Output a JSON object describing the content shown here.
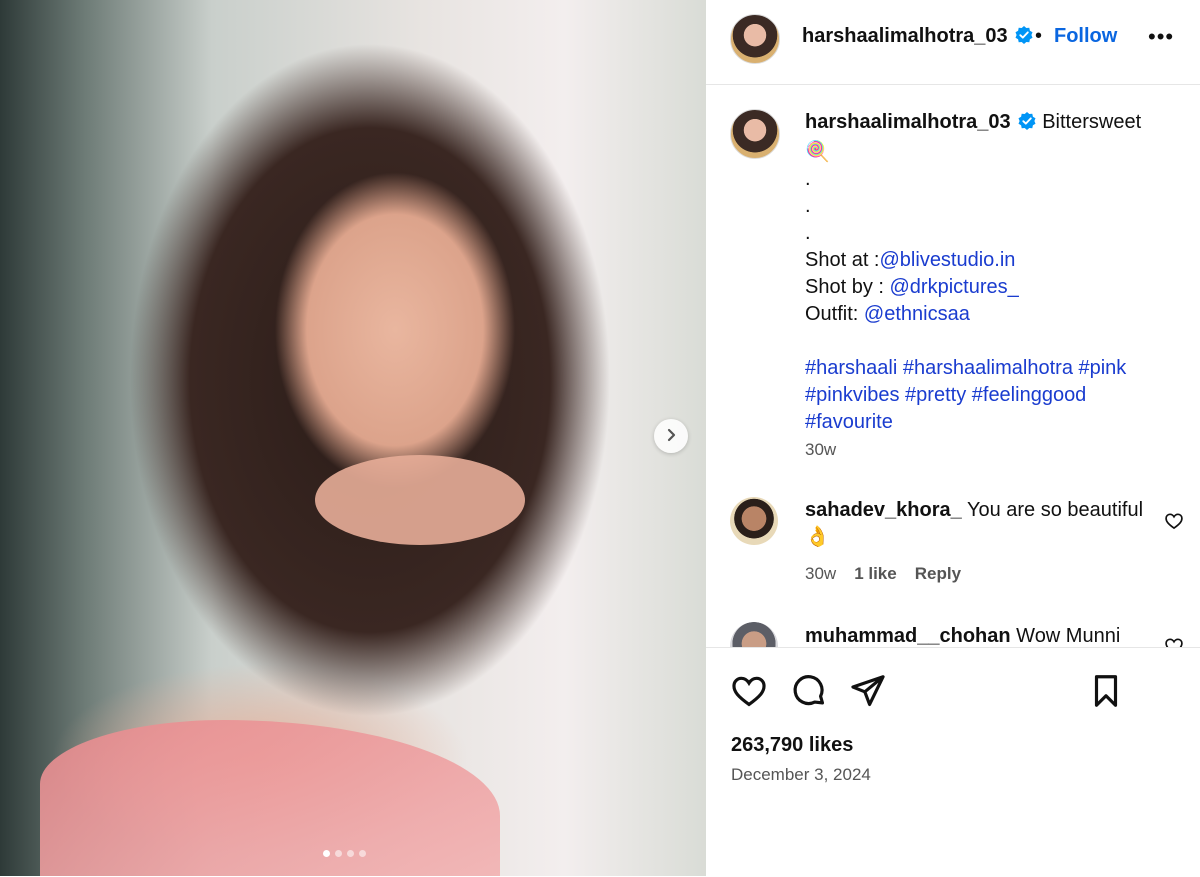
{
  "post": {
    "username": "harshaalimalhotra_03",
    "verified": true,
    "separator": "•",
    "follow_label": "Follow",
    "more_label": "•••",
    "carousel": {
      "total_slides": 4,
      "active_index": 0,
      "next_label": "Next"
    }
  },
  "caption": {
    "username": "harshaalimalhotra_03",
    "text_first": "Bittersweet",
    "emoji": "🍭",
    "dot1": ".",
    "dot2": ".",
    "dot3": ".",
    "shot_at_prefix": "Shot at :",
    "shot_at_link": "@blivestudio.in",
    "shot_by_prefix": "Shot by : ",
    "shot_by_link": "@drkpictures_",
    "outfit_prefix": "Outfit: ",
    "outfit_link": "@ethnicsaa",
    "hashtags_line1": "#harshaali #harshaalimalhotra #pink",
    "hashtags_line2": "#pinkvibes #pretty #feelinggood",
    "hashtags_line3": "#favourite",
    "time": "30w"
  },
  "comments": [
    {
      "username": "sahadev_khora_",
      "text": "You are so beautiful",
      "emoji": "👌",
      "time": "30w",
      "likes": "1 like",
      "reply_label": "Reply"
    },
    {
      "username": "muhammad__chohan",
      "text": "Wow Munni"
    }
  ],
  "footer": {
    "likes": "263,790 likes",
    "date": "December 3, 2024"
  },
  "colors": {
    "link": "#1a3ccf",
    "follow": "#0a66e0",
    "verified": "#0095f6"
  }
}
